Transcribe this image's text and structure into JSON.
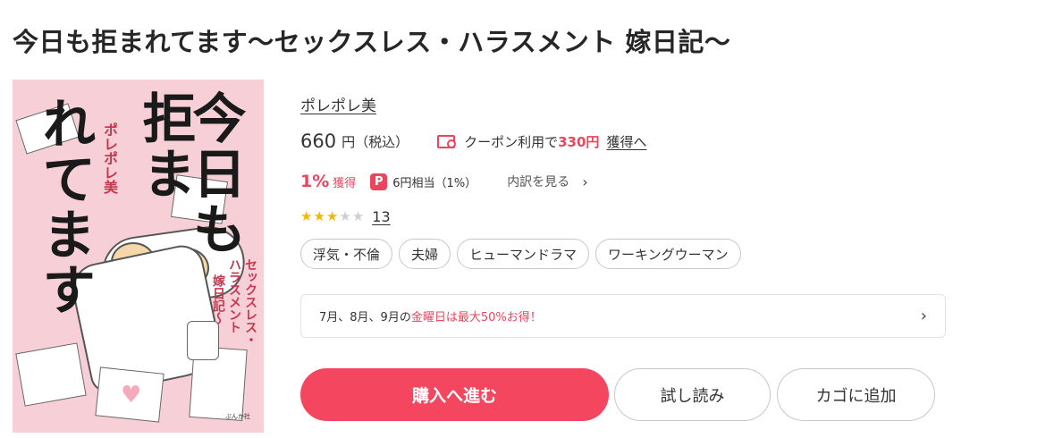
{
  "book": {
    "title": "今日も拒まれてます〜セックスレス・ハラスメント 嫁日記〜",
    "author": "ポレポレ美"
  },
  "cover": {
    "title_line1": "今日も",
    "title_line2": "拒ま",
    "title_line3": "れてます",
    "author": "ポレポレ美",
    "subtitle_line1": "セックスレス・",
    "subtitle_line2": "ハラスメント",
    "subtitle_line3": "嫁日記〜",
    "publisher": "ぶんか社"
  },
  "price": {
    "amount": "660",
    "unit": "円（税込）",
    "coupon_prefix": "クーポン利用で",
    "coupon_amount": "330円",
    "coupon_link": "獲得へ",
    "coupon_icon": "coupon-ticket-icon"
  },
  "points": {
    "percent": "1%",
    "earn_label": "獲得",
    "paypay_icon_label": "P",
    "equivalent": "6円相当（1%）",
    "breakdown_label": "内訳を見る",
    "chevron": "›"
  },
  "rating": {
    "stars_filled": 3,
    "stars_total": 5,
    "star_glyph": "★",
    "review_count": "13"
  },
  "tags": [
    "浮気・不倫",
    "夫婦",
    "ヒューマンドラマ",
    "ワーキングウーマン"
  ],
  "banner": {
    "prefix": "7月、8月、9月の",
    "highlight": "金曜日は最大50%お得！",
    "chevron": "›"
  },
  "actions": {
    "buy_label": "購入へ進む",
    "sample_label": "試し読み",
    "cart_label": "カゴに追加"
  },
  "colors": {
    "accent": "#f4475f",
    "star": "#f2b705",
    "cover_bg": "#f7cfd6"
  }
}
